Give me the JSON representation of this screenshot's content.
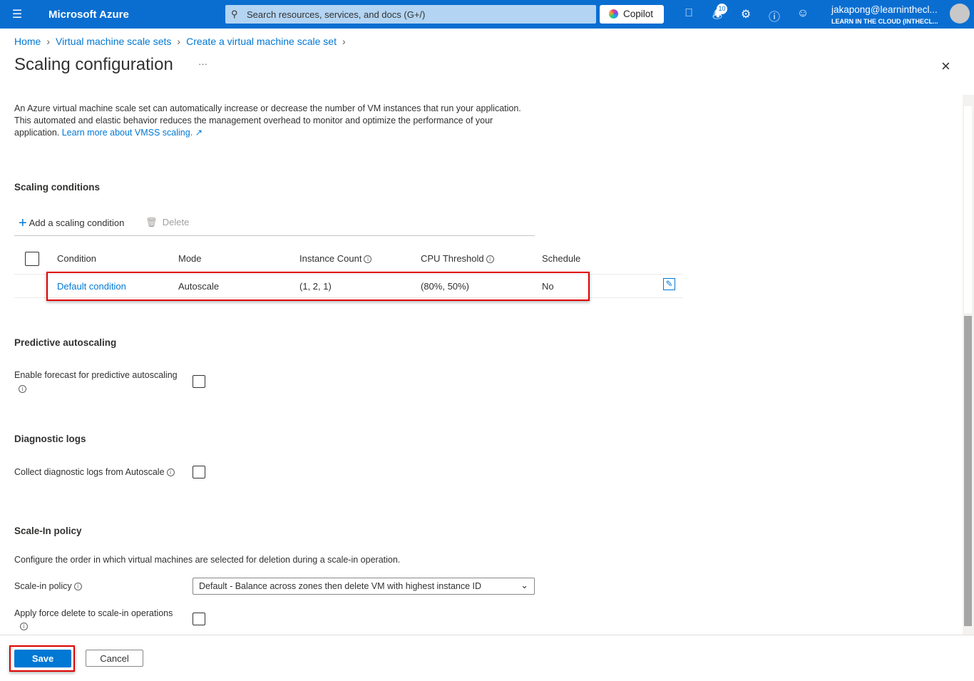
{
  "topbar": {
    "menu_icon": "hamburger-icon",
    "brand": "Microsoft Azure",
    "search_placeholder": "Search resources, services, and docs (G+/)",
    "copilot": "Copilot",
    "notification_count": "10",
    "user_name": "jakapong@learninthecl...",
    "user_org": "LEARN IN THE CLOUD (INTHECL..."
  },
  "breadcrumb": [
    "Home",
    "Virtual machine scale sets",
    "Create a virtual machine scale set"
  ],
  "page": {
    "title": "Scaling configuration",
    "more": "···",
    "description": "An Azure virtual machine scale set can automatically increase or decrease the number of VM instances that run your application. This automated and elastic behavior reduces the management overhead to monitor and optimize the performance of your application.",
    "learn_more": "Learn more about VMSS scaling."
  },
  "scaling": {
    "heading": "Scaling conditions",
    "add": "Add a scaling condition",
    "delete": "Delete",
    "columns": [
      "Condition",
      "Mode",
      "Instance Count",
      "CPU Threshold",
      "Schedule"
    ],
    "rows": [
      {
        "condition": "Default condition",
        "mode": "Autoscale",
        "instance_count": "(1, 2, 1)",
        "cpu_threshold": "(80%, 50%)",
        "schedule": "No"
      }
    ]
  },
  "predictive": {
    "heading": "Predictive autoscaling",
    "label": "Enable forecast for predictive autoscaling",
    "checked": false
  },
  "diagnostic": {
    "heading": "Diagnostic logs",
    "label": "Collect diagnostic logs from Autoscale",
    "checked": false
  },
  "scalein": {
    "heading": "Scale-In policy",
    "description": "Configure the order in which virtual machines are selected for deletion during a scale-in operation.",
    "policy_label": "Scale-in policy",
    "policy_value": "Default - Balance across zones then delete VM with highest instance ID",
    "force_label": "Apply force delete to scale-in operations",
    "force_checked": false
  },
  "footer": {
    "save": "Save",
    "cancel": "Cancel"
  },
  "colors": {
    "brand": "#0a6ed1",
    "link": "#0078d4",
    "highlight": "#e00000"
  }
}
